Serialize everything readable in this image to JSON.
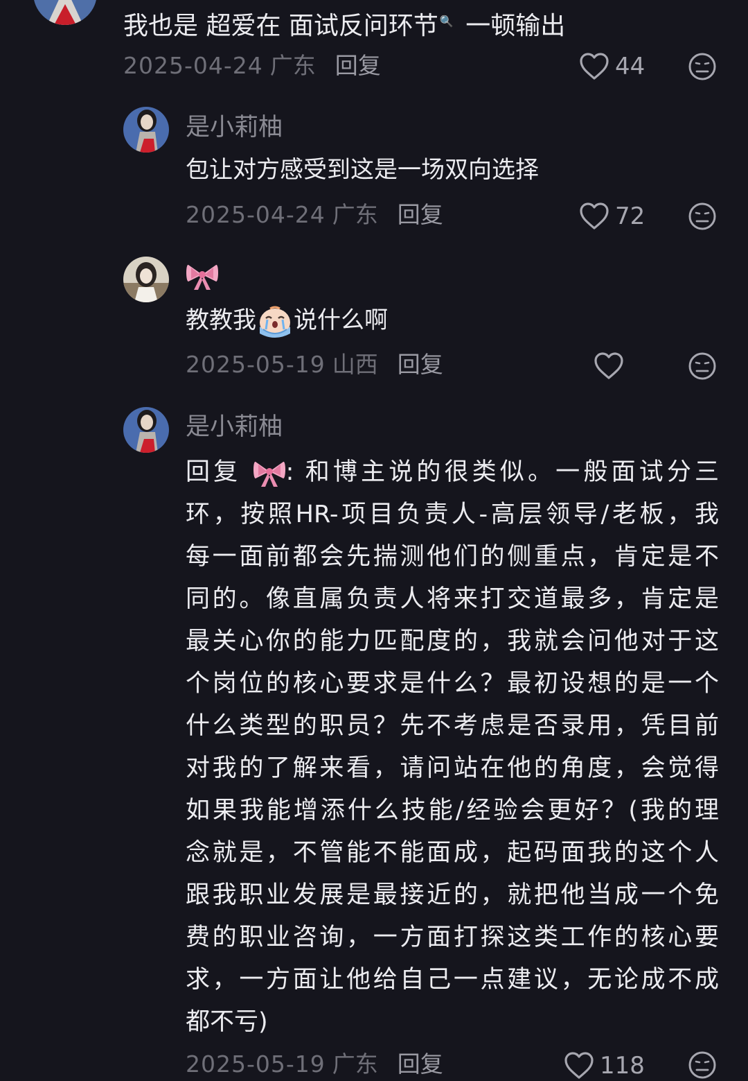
{
  "comments": [
    {
      "text_before": "我也是 超爱在 面试反问环节",
      "search_glyph": "🔍",
      "text_after": " 一顿输出",
      "date": "2025-04-24",
      "region": "广东",
      "reply_label": "回复",
      "likes": "44"
    },
    {
      "username": "是小莉柚",
      "text": "包让对方感受到这是一场双向选择",
      "date": "2025-04-24",
      "region": "广东",
      "reply_label": "回复",
      "likes": "72"
    },
    {
      "username_icon": "bow-emoji",
      "text_before": "教教我",
      "text_after": "说什么啊",
      "emoji": "crying-emoji",
      "date": "2025-05-19",
      "region": "山西",
      "reply_label": "回复",
      "likes": ""
    },
    {
      "username": "是小莉柚",
      "reply_prefix": "回复",
      "reply_target_icon": "bow-emoji",
      "lines": [
        ": 和博主说的很类似。一般面试分三",
        "环，按照HR-项目负责人-高层领导/老板，我",
        "每一面前都会先揣测他们的侧重点，肯定是不",
        "同的。像直属负责人将来打交道最多，肯定是",
        "最关心你的能力匹配度的，我就会问他对于这",
        "个岗位的核心要求是什么？最初设想的是一个",
        "什么类型的职员？先不考虑是否录用，凭目前",
        "对我的了解来看，请问站在他的角度，会觉得",
        "如果我能增添什么技能/经验会更好？(我的理",
        "念就是，不管能不能面成，起码面我的这个人",
        "跟我职业发展是最接近的，就把他当成一个免",
        "费的职业咨询，一方面打探这类工作的核心要",
        "求，一方面让他给自己一点建议，无论成不成",
        "都不亏)"
      ],
      "date": "2025-05-19",
      "region": "广东",
      "reply_label": "回复",
      "likes": "118"
    }
  ],
  "colors": {
    "background": "#15151d",
    "text": "#ececf0",
    "muted": "#6f6f78",
    "username": "#8a8a93"
  }
}
